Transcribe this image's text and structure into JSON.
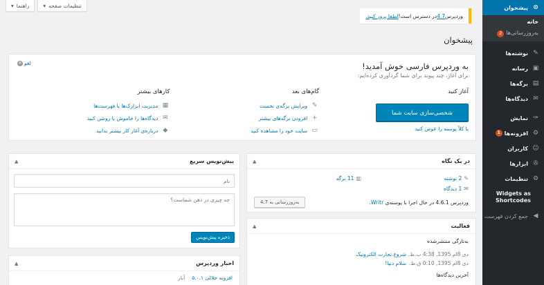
{
  "screen_meta": {
    "options_label": "تنظیمات صفحه",
    "help_label": "راهنما",
    "caret": "▾"
  },
  "update_nag": {
    "before": "وردپرس ",
    "version_link": "4.7",
    "middle": " در دسترس است! ",
    "update_link": "لطفا بروز کنید."
  },
  "page_title": "پیشخوان",
  "sidebar": {
    "items": [
      {
        "icon": "⊙",
        "label": "پیشخوان"
      },
      {
        "icon": "✎",
        "label": "نوشته‌ها"
      },
      {
        "icon": "▣",
        "label": "رسانه"
      },
      {
        "icon": "▤",
        "label": "برگه‌ها"
      },
      {
        "icon": "✉",
        "label": "دیدگاه‌ها"
      },
      {
        "icon": "✑",
        "label": "نمایش"
      },
      {
        "icon": "⚙",
        "label": "افزونه‌ها",
        "badge": "1"
      },
      {
        "icon": "☺",
        "label": "کاربران"
      },
      {
        "icon": "✇",
        "label": "ابزارها"
      },
      {
        "icon": "⚙",
        "label": "تنظیمات"
      },
      {
        "label": "Widgets as Shortcodes"
      },
      {
        "icon": "◀",
        "label": "جمع کردن فهرست"
      }
    ],
    "submenu": [
      {
        "label": "خانه"
      },
      {
        "label": "به‌روزرسانی‌ها",
        "badge": "2"
      }
    ]
  },
  "welcome": {
    "title": "به وردپرس فارسی خوش آمدید!",
    "about": "برای آغاز، چند پیوند برای شما گردآوری کرده‌ایم:",
    "dismiss": "لغو",
    "col1": {
      "heading": "آغاز کنید",
      "button": "شخصی‌سازی سایت شما",
      "or_link": "یا کلاً پوسته را عوض کنید"
    },
    "col2": {
      "heading": "گام‌های بعد",
      "links": [
        {
          "icon": "✎",
          "label": "ویرایش برگه‌ی نخست"
        },
        {
          "icon": "+",
          "label": "افزودن برگه‌های بیشتر"
        },
        {
          "icon": "▭",
          "label": "سایت خود را مشاهده کنید"
        }
      ]
    },
    "col3": {
      "heading": "کارهای بیشتر",
      "links": [
        {
          "icon": "▦",
          "label": "مدیریت ابزارک‌ها یا فهرست‌ها"
        },
        {
          "icon": "✉",
          "label": "دیدگاه‌ها را خاموش یا روشن کنید"
        },
        {
          "icon": "◆",
          "label": "درباره‌ی آغاز کار بیشتر بدانید"
        }
      ]
    }
  },
  "glance": {
    "title": "در یک نگاه",
    "posts": "2 نوشته",
    "pages": "11 برگه",
    "comments": "1 دیدگاه",
    "version_text_before": "وردپرس 4.6.1 در حال اجرا با پوسته‌ی ",
    "theme_link": "Writr",
    "version_text_after": ".",
    "update_button": "به‌روزرسانی به 4.7",
    "icons": {
      "post": "✎",
      "page": "▥",
      "comment": "✉"
    }
  },
  "activity": {
    "title": "فعالیت",
    "recently_published": "به‌تازگی منتشرشده",
    "rows": [
      {
        "date": "دی 8ام 1395, 4:38 ب.ظ.",
        "title": "شروع تجارت الکترونیک"
      },
      {
        "date": "دی 8ام 1395, 0:10 ق.ظ.",
        "title": "سلام دنیا!"
      }
    ],
    "recent_comments": "آخرین دیدگاه‌ها"
  },
  "quickpress": {
    "title": "پیش‌نویس سریع",
    "title_placeholder": "نام",
    "content_placeholder": "چه چیزی در ذهن شماست؟",
    "save_button": "ذخیره پیش‌نویس"
  },
  "news": {
    "title": "اخبار وردپرس",
    "item_title": "افزونه جلالی ۵.۰.۱",
    "item_source": "آبار"
  },
  "toggle_icon": "▲"
}
